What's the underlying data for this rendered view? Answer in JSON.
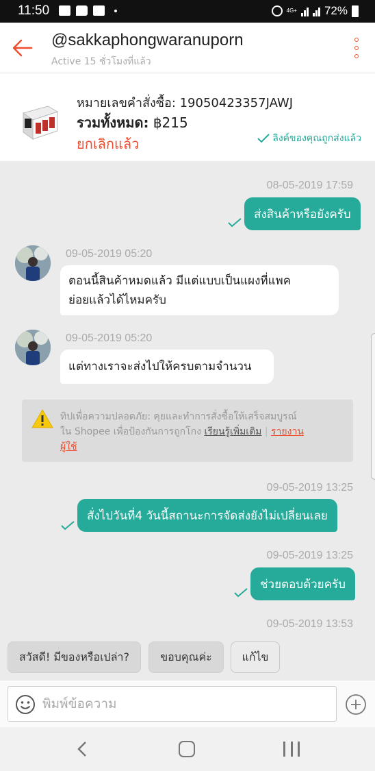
{
  "statusbar": {
    "time": "11:50",
    "network": "4G+",
    "battery": "72%"
  },
  "header": {
    "username": "@sakkaphongwaranuporn",
    "status": "Active 15 ชั่วโมงที่แล้ว"
  },
  "order": {
    "order_label": "หมายเลขคำสั่งซื้อ: 19050423357JAWJ",
    "total_label": "รวมทั้งหมด:",
    "total_value": "฿215",
    "status": "ยกเลิกแล้ว",
    "link_sent": "ลิงค์ของคุณถูกส่งแล้ว"
  },
  "messages": [
    {
      "from": "me",
      "timestamp": "08-05-2019 17:59",
      "text": "ส่งสินค้าหรือยังครับ"
    },
    {
      "from": "seller",
      "timestamp": "09-05-2019 05:20",
      "lines": [
        "ตอนนี้สินค้าหมดแล้ว มีแต่แบบเป็นแผงที่แพค",
        "ย่อยแล้วได้ไหมครับ"
      ]
    },
    {
      "from": "seller",
      "timestamp": "09-05-2019 05:20",
      "text": "แต่ทางเราจะส่งไปให้ครบตามจำนวน"
    },
    {
      "from": "me",
      "timestamp": "09-05-2019 13:25",
      "text": "สั่งไปวันที่4 วันนี้สถานะการจัดส่งยังไม่เปลี่ยนเลย"
    },
    {
      "from": "me",
      "timestamp": "09-05-2019 13:25",
      "text": "ช่วยตอบด้วยครับ"
    },
    {
      "from": "me",
      "timestamp": "09-05-2019 13:53",
      "text": ""
    }
  ],
  "tip": {
    "text1": "ทิปเพื่อความปลอดภัย: คุยและทำการสั่งซื้อให้เสร็จสมบูรณ์",
    "text2": "ใน Shopee เพื่อป้องกันการถูกโกง",
    "learn_more": "เรียนรู้เพิ่มเติม",
    "separator": "|",
    "report1": "รายงาน",
    "report2": "ผู้ใช้"
  },
  "quick_replies": [
    "สวัสดี! มีของหรือเปล่า?",
    "ขอบคุณค่ะ",
    "แก้ไข"
  ],
  "input": {
    "placeholder": "พิมพ์ข้อความ"
  },
  "colors": {
    "accent": "#ee4d2d",
    "bubble": "#26aa99"
  },
  "icons": [
    "back-arrow-icon",
    "more-vertical-icon",
    "check-icon",
    "warning-icon",
    "emoji-icon",
    "plus-icon"
  ]
}
